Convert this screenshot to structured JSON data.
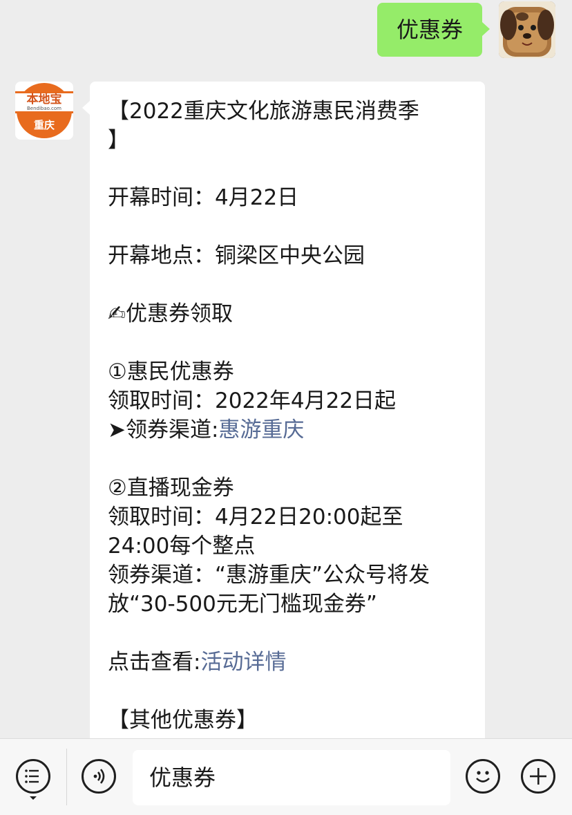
{
  "outgoing": {
    "text": "优惠券"
  },
  "account": {
    "logo_text": "本地宝",
    "logo_sub": "Bendibao.com",
    "logo_city": "重庆"
  },
  "message": {
    "title_line1": "【2022重庆文化旅游惠民消费季",
    "title_line2": "】",
    "open_time": "开幕时间：4月22日",
    "open_place": "开幕地点：铜梁区中央公园",
    "coupon_heading": "✍优惠券领取",
    "c1_title": "①惠民优惠券",
    "c1_time": "领取时间：2022年4月22日起",
    "c1_channel_label": "➤领券渠道:",
    "c1_channel_link": "惠游重庆",
    "c2_title": "②直播现金券",
    "c2_time_line1": "领取时间：4月22日20:00起至",
    "c2_time_line2": "24:00每个整点",
    "c2_channel_line1": "领券渠道：“惠游重庆”公众号将发",
    "c2_channel_line2": "放“30-500元无门槛现金券”",
    "detail_label": "点击查看:",
    "detail_link": "活动详情",
    "other_heading": "【其他优惠券】"
  },
  "input_bar": {
    "menu_icon": "list-menu-icon",
    "voice_icon": "voice-icon",
    "input_value": "优惠券",
    "emoji_icon": "emoji-icon",
    "plus_icon": "plus-icon"
  },
  "colors": {
    "outgoing_bubble": "#95ec69",
    "link": "#576b95",
    "brand_orange": "#e86b1e"
  }
}
